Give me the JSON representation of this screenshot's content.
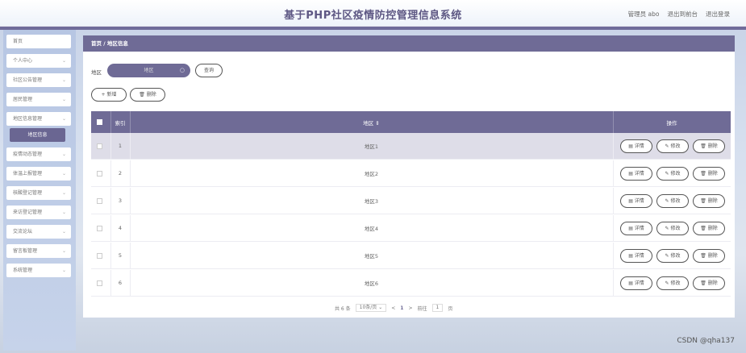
{
  "header": {
    "title": "基于PHP社区疫情防控管理信息系统",
    "admin": "管理员 abo",
    "to_front": "退出到前台",
    "logout": "退出登录"
  },
  "sidebar": {
    "items": [
      {
        "label": "首页",
        "chevron": ""
      },
      {
        "label": "个人中心",
        "chevron": "⌄"
      },
      {
        "label": "社区公告管理",
        "chevron": "⌄"
      },
      {
        "label": "居民管理",
        "chevron": "⌄"
      },
      {
        "label": "地区信息管理",
        "chevron": "⌄"
      },
      {
        "label": "疫情动态管理",
        "chevron": "⌄"
      },
      {
        "label": "体温上报管理",
        "chevron": "⌄"
      },
      {
        "label": "核酸登记管理",
        "chevron": "⌄"
      },
      {
        "label": "来访登记管理",
        "chevron": "⌄"
      },
      {
        "label": "交流论坛",
        "chevron": "⌄"
      },
      {
        "label": "留言板管理",
        "chevron": "⌄"
      },
      {
        "label": "系统管理",
        "chevron": "⌄"
      }
    ],
    "active_sub": "地区信息"
  },
  "breadcrumb": {
    "text": "首页 / 地区信息"
  },
  "filter": {
    "label": "地区",
    "placeholder": "地区",
    "query_button": "查询",
    "add_button": "+ 新增",
    "delete_button": "🗑 删除"
  },
  "table": {
    "headers": {
      "index": "索引",
      "region": "地区 ⇕",
      "ops": "操作"
    },
    "rows": [
      {
        "index": "1",
        "region": "地区1"
      },
      {
        "index": "2",
        "region": "地区2"
      },
      {
        "index": "3",
        "region": "地区3"
      },
      {
        "index": "4",
        "region": "地区4"
      },
      {
        "index": "5",
        "region": "地区5"
      },
      {
        "index": "6",
        "region": "地区6"
      }
    ],
    "op_labels": {
      "detail": "▤ 详情",
      "edit": "✎ 修改",
      "delete": "🗑 删除"
    }
  },
  "pager": {
    "total": "共 6 条",
    "page_size": "10条/页 ⌄",
    "prev": "<",
    "page": "1",
    "next": ">",
    "goto_prefix": "前往",
    "goto_value": "1",
    "goto_suffix": "页"
  },
  "watermark": "CSDN @qha137",
  "colors": {
    "accent": "#6f6b96",
    "title": "#5e5884"
  }
}
